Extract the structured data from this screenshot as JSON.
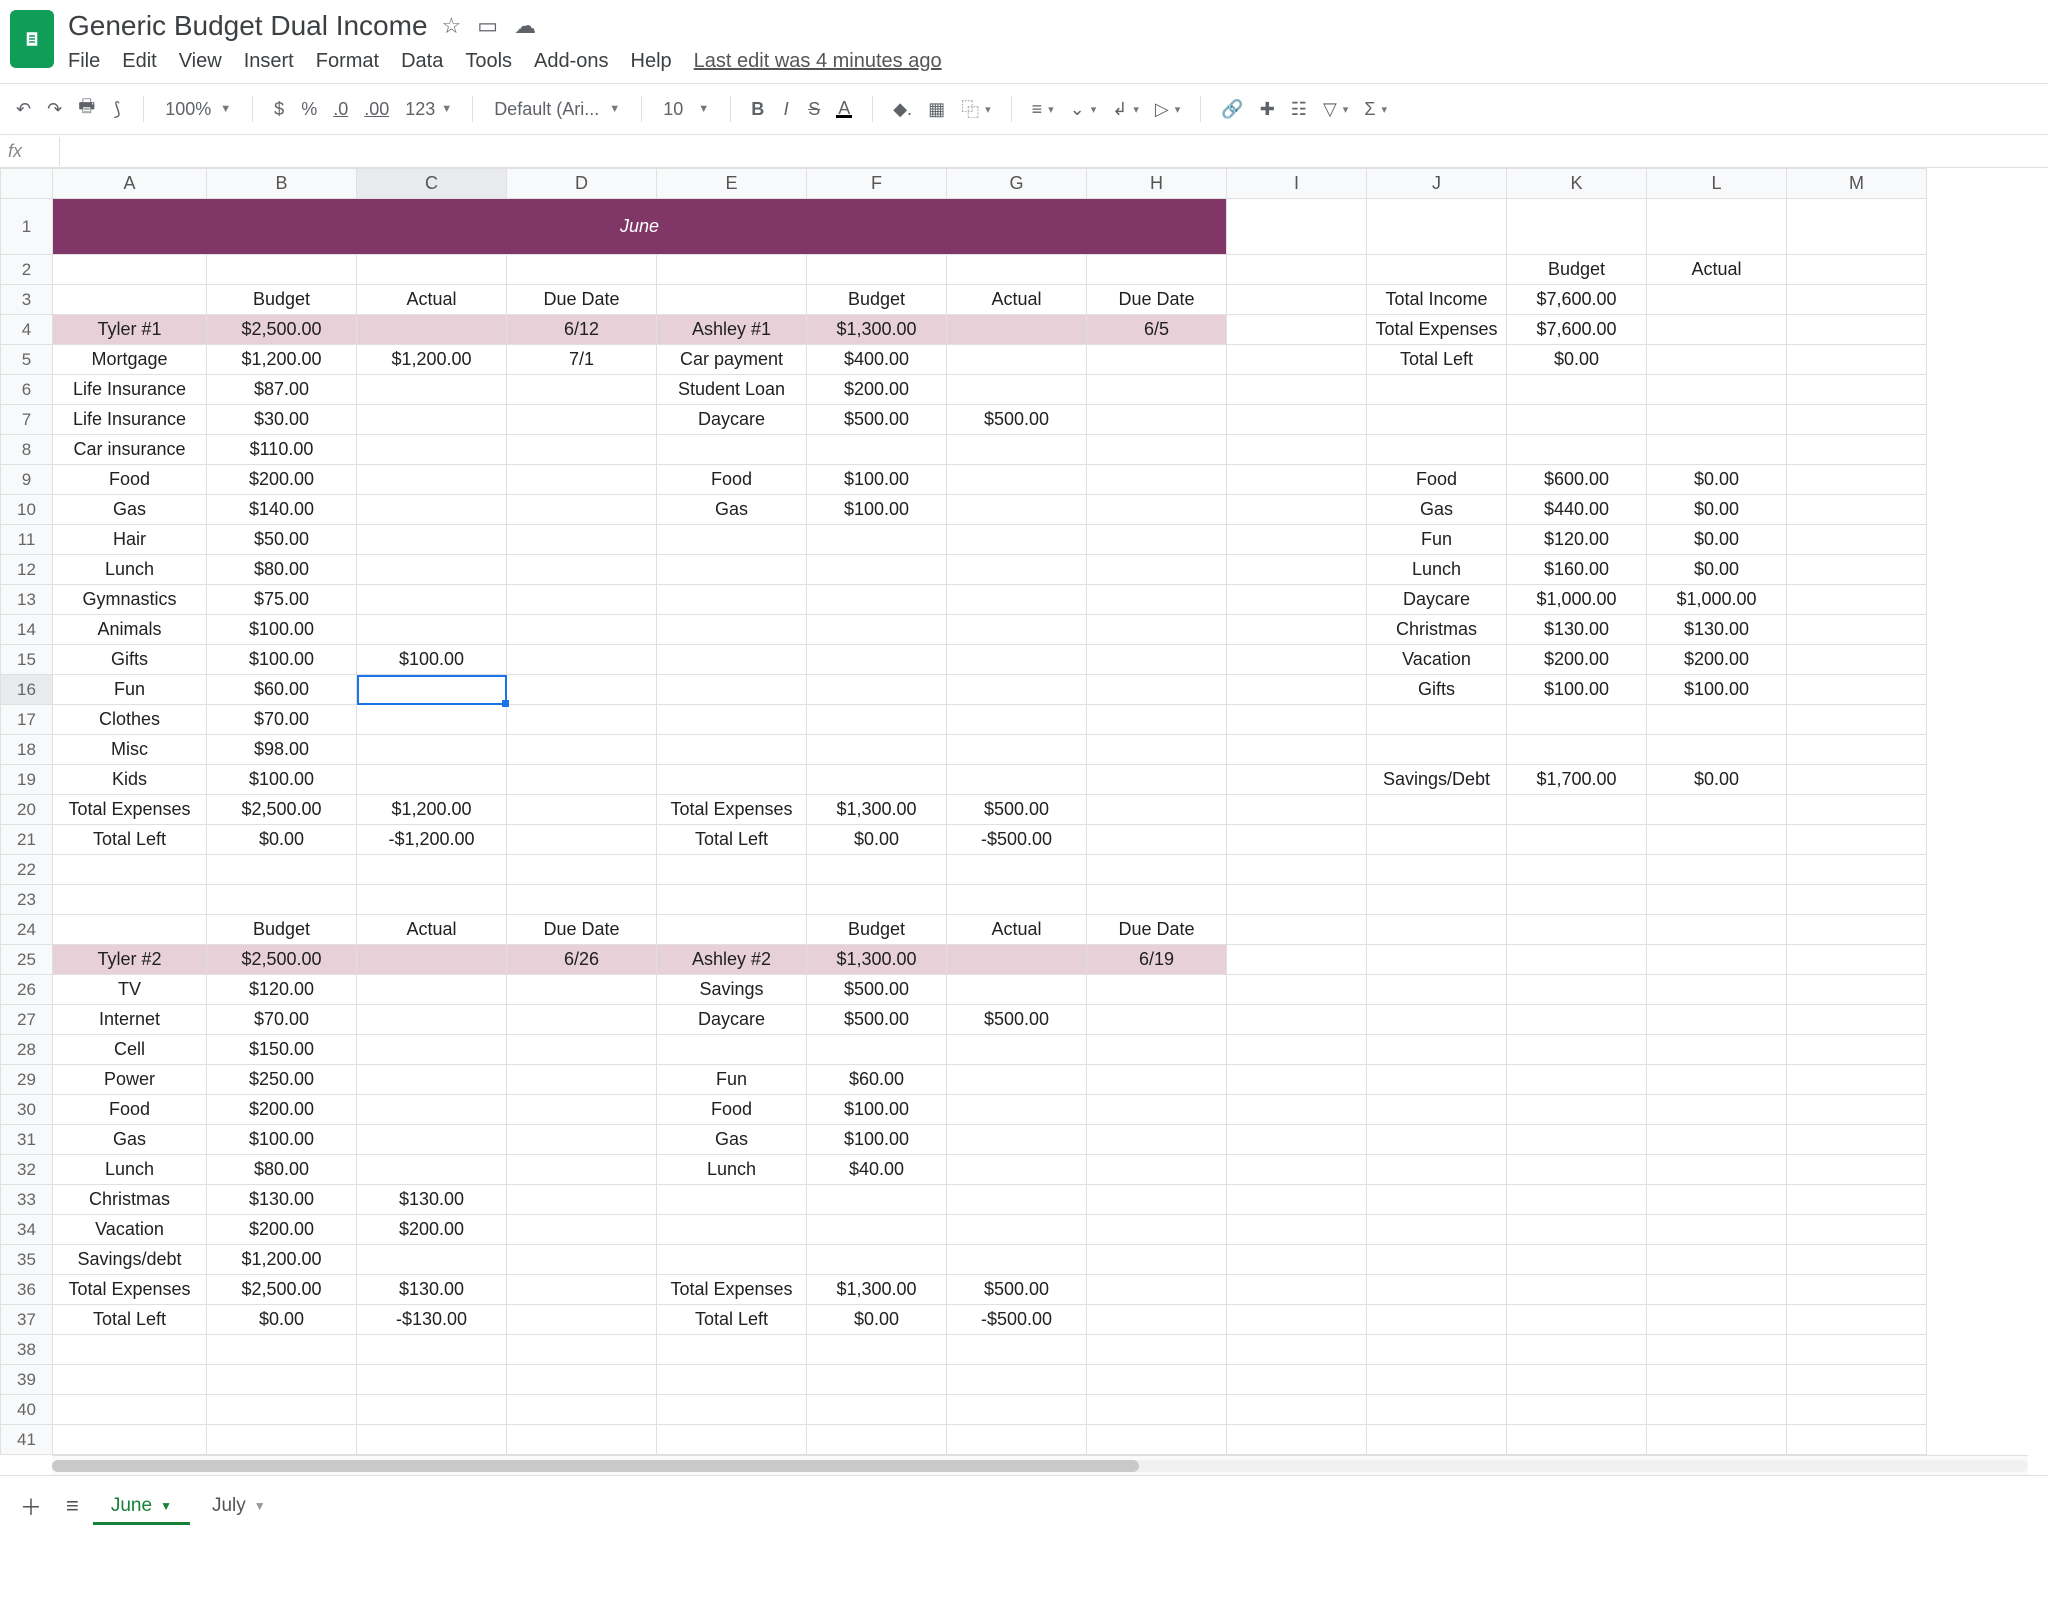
{
  "doc": {
    "title": "Generic Budget  Dual Income",
    "last_edit": "Last edit was 4 minutes ago"
  },
  "menu": {
    "file": "File",
    "edit": "Edit",
    "view": "View",
    "insert": "Insert",
    "format": "Format",
    "data": "Data",
    "tools": "Tools",
    "addons": "Add-ons",
    "help": "Help"
  },
  "toolbar": {
    "zoom": "100%",
    "currency": "$",
    "percent": "%",
    "dec_dec": ".0",
    "inc_dec": ".00",
    "fmt123": "123",
    "font": "Default (Ari...",
    "fontsize": "10"
  },
  "namebox": "fx",
  "columns": [
    "A",
    "B",
    "C",
    "D",
    "E",
    "F",
    "G",
    "H",
    "I",
    "J",
    "K",
    "L",
    "M"
  ],
  "rows": [
    {
      "n": 1,
      "merge": true,
      "text": "June",
      "class": "title-cell"
    },
    {
      "n": 2,
      "c": {
        "K": "Budget",
        "L": "Actual"
      }
    },
    {
      "n": 3,
      "c": {
        "B": "Budget",
        "C": "Actual",
        "D": "Due Date",
        "F": "Budget",
        "G": "Actual",
        "H": "Due Date",
        "J": "Total Income",
        "K": "$7,600.00"
      }
    },
    {
      "n": 4,
      "class": "pink",
      "c": {
        "A": "Tyler #1",
        "B": "$2,500.00",
        "D": "6/12",
        "E": "Ashley #1",
        "F": "$1,300.00",
        "H": "6/5",
        "J": "Total Expenses",
        "K": "$7,600.00"
      }
    },
    {
      "n": 5,
      "c": {
        "A": "Mortgage",
        "B": "$1,200.00",
        "C": "$1,200.00",
        "D": "7/1",
        "E": "Car payment",
        "F": "$400.00",
        "J": "Total Left",
        "K": "$0.00"
      }
    },
    {
      "n": 6,
      "c": {
        "A": "Life Insurance",
        "B": "$87.00",
        "E": "Student Loan",
        "F": "$200.00"
      }
    },
    {
      "n": 7,
      "c": {
        "A": "Life Insurance",
        "B": "$30.00",
        "E": "Daycare",
        "F": "$500.00",
        "G": "$500.00"
      }
    },
    {
      "n": 8,
      "c": {
        "A": "Car insurance",
        "B": "$110.00"
      }
    },
    {
      "n": 9,
      "c": {
        "A": "Food",
        "B": "$200.00",
        "E": "Food",
        "F": "$100.00",
        "J": "Food",
        "K": "$600.00",
        "L": "$0.00"
      }
    },
    {
      "n": 10,
      "c": {
        "A": "Gas",
        "B": "$140.00",
        "E": "Gas",
        "F": "$100.00",
        "J": "Gas",
        "K": "$440.00",
        "L": "$0.00"
      }
    },
    {
      "n": 11,
      "c": {
        "A": "Hair",
        "B": "$50.00",
        "J": "Fun",
        "K": "$120.00",
        "L": "$0.00"
      }
    },
    {
      "n": 12,
      "c": {
        "A": "Lunch",
        "B": "$80.00",
        "J": "Lunch",
        "K": "$160.00",
        "L": "$0.00"
      }
    },
    {
      "n": 13,
      "c": {
        "A": "Gymnastics",
        "B": "$75.00",
        "J": "Daycare",
        "K": "$1,000.00",
        "L": "$1,000.00"
      }
    },
    {
      "n": 14,
      "c": {
        "A": "Animals",
        "B": "$100.00",
        "J": "Christmas",
        "K": "$130.00",
        "L": "$130.00"
      }
    },
    {
      "n": 15,
      "c": {
        "A": "Gifts",
        "B": "$100.00",
        "C": "$100.00",
        "J": "Vacation",
        "K": "$200.00",
        "L": "$200.00"
      }
    },
    {
      "n": 16,
      "active": "C",
      "c": {
        "A": "Fun",
        "B": "$60.00",
        "J": "Gifts",
        "K": "$100.00",
        "L": "$100.00"
      }
    },
    {
      "n": 17,
      "c": {
        "A": "Clothes",
        "B": "$70.00"
      }
    },
    {
      "n": 18,
      "c": {
        "A": "Misc",
        "B": "$98.00"
      }
    },
    {
      "n": 19,
      "c": {
        "A": "Kids",
        "B": "$100.00",
        "J": "Savings/Debt",
        "K": "$1,700.00",
        "L": "$0.00"
      }
    },
    {
      "n": 20,
      "c": {
        "A": "Total Expenses",
        "B": "$2,500.00",
        "C": "$1,200.00",
        "E": "Total Expenses",
        "F": "$1,300.00",
        "G": "$500.00"
      }
    },
    {
      "n": 21,
      "c": {
        "A": "Total Left",
        "B": "$0.00",
        "C": "-$1,200.00",
        "E": "Total Left",
        "F": "$0.00",
        "G": "-$500.00"
      }
    },
    {
      "n": 22,
      "c": {}
    },
    {
      "n": 23,
      "c": {}
    },
    {
      "n": 24,
      "c": {
        "B": "Budget",
        "C": "Actual",
        "D": "Due Date",
        "F": "Budget",
        "G": "Actual",
        "H": "Due Date"
      }
    },
    {
      "n": 25,
      "class": "pink",
      "c": {
        "A": "Tyler #2",
        "B": "$2,500.00",
        "D": "6/26",
        "E": "Ashley #2",
        "F": "$1,300.00",
        "H": "6/19"
      }
    },
    {
      "n": 26,
      "c": {
        "A": "TV",
        "B": "$120.00",
        "E": "Savings",
        "F": "$500.00"
      }
    },
    {
      "n": 27,
      "c": {
        "A": "Internet",
        "B": "$70.00",
        "E": "Daycare",
        "F": "$500.00",
        "G": "$500.00"
      }
    },
    {
      "n": 28,
      "c": {
        "A": "Cell",
        "B": "$150.00"
      }
    },
    {
      "n": 29,
      "c": {
        "A": "Power",
        "B": "$250.00",
        "E": "Fun",
        "F": "$60.00"
      }
    },
    {
      "n": 30,
      "c": {
        "A": "Food",
        "B": "$200.00",
        "E": "Food",
        "F": "$100.00"
      }
    },
    {
      "n": 31,
      "c": {
        "A": "Gas",
        "B": "$100.00",
        "E": "Gas",
        "F": "$100.00"
      }
    },
    {
      "n": 32,
      "c": {
        "A": "Lunch",
        "B": "$80.00",
        "E": "Lunch",
        "F": "$40.00"
      }
    },
    {
      "n": 33,
      "c": {
        "A": "Christmas",
        "B": "$130.00",
        "C": "$130.00"
      }
    },
    {
      "n": 34,
      "c": {
        "A": "Vacation",
        "B": "$200.00",
        "C": "$200.00"
      }
    },
    {
      "n": 35,
      "c": {
        "A": "Savings/debt",
        "B": "$1,200.00"
      }
    },
    {
      "n": 36,
      "c": {
        "A": "Total Expenses",
        "B": "$2,500.00",
        "C": "$130.00",
        "E": "Total Expenses",
        "F": "$1,300.00",
        "G": "$500.00"
      }
    },
    {
      "n": 37,
      "c": {
        "A": "Total Left",
        "B": "$0.00",
        "C": "-$130.00",
        "E": "Total Left",
        "F": "$0.00",
        "G": "-$500.00"
      }
    },
    {
      "n": 38,
      "c": {}
    },
    {
      "n": 39,
      "c": {}
    },
    {
      "n": 40,
      "c": {}
    },
    {
      "n": 41,
      "c": {}
    }
  ],
  "tabs": {
    "june": "June",
    "july": "July"
  }
}
